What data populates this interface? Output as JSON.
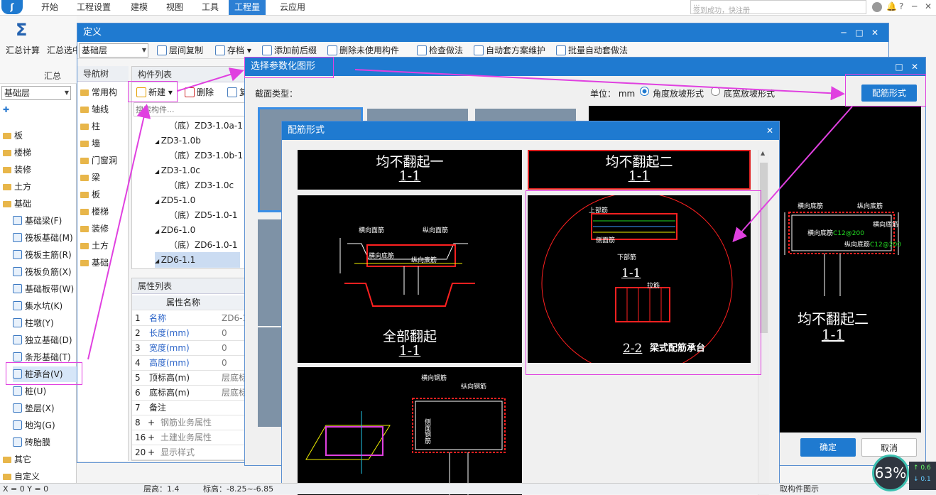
{
  "menubar": {
    "items": [
      "开始",
      "工程设置",
      "建模",
      "视图",
      "工具",
      "工程量",
      "云应用"
    ],
    "active": "工程量",
    "hint_lines": [
      "...",
      "签到成功，快注册"
    ]
  },
  "ribbon": {
    "btn1": "汇总计算",
    "btn2": "汇总选中",
    "group": "汇总"
  },
  "left_panel": {
    "layer": "基础层",
    "tree": [
      {
        "label": "板",
        "kind": "folder",
        "indent": 0
      },
      {
        "label": "楼梯",
        "kind": "folder",
        "indent": 0
      },
      {
        "label": "装修",
        "kind": "folder",
        "indent": 0
      },
      {
        "label": "土方",
        "kind": "folder",
        "indent": 0
      },
      {
        "label": "基础",
        "kind": "folder",
        "indent": 0
      },
      {
        "label": "基础梁(F)",
        "kind": "item",
        "indent": 1
      },
      {
        "label": "筏板基础(M)",
        "kind": "item",
        "indent": 1
      },
      {
        "label": "筏板主筋(R)",
        "kind": "item",
        "indent": 1
      },
      {
        "label": "筏板负筋(X)",
        "kind": "item",
        "indent": 1
      },
      {
        "label": "基础板带(W)",
        "kind": "item",
        "indent": 1
      },
      {
        "label": "集水坑(K)",
        "kind": "item",
        "indent": 1
      },
      {
        "label": "柱墩(Y)",
        "kind": "item",
        "indent": 1
      },
      {
        "label": "独立基础(D)",
        "kind": "item",
        "indent": 1
      },
      {
        "label": "条形基础(T)",
        "kind": "item",
        "indent": 1
      },
      {
        "label": "桩承台(V)",
        "kind": "item",
        "indent": 1
      },
      {
        "label": "桩(U)",
        "kind": "item",
        "indent": 1
      },
      {
        "label": "垫层(X)",
        "kind": "item",
        "indent": 1
      },
      {
        "label": "地沟(G)",
        "kind": "item",
        "indent": 1
      },
      {
        "label": "砖胎膜",
        "kind": "item",
        "indent": 1
      },
      {
        "label": "其它",
        "kind": "folder",
        "indent": 0
      },
      {
        "label": "自定义",
        "kind": "folder",
        "indent": 0
      }
    ]
  },
  "define_window": {
    "title": "定义",
    "layer": "基础层",
    "toolbar": [
      "层间复制",
      "存档",
      "添加前后缀",
      "删除未使用构件",
      "检查做法",
      "自动套方案维护",
      "批量自动套做法"
    ],
    "nav_title": "导航树",
    "nav_items": [
      "常用构",
      "轴线",
      "柱",
      "墙",
      "门窗洞",
      "梁",
      "板",
      "楼梯",
      "装修",
      "土方",
      "基础"
    ],
    "comp_title": "构件列表",
    "new_label": "新建",
    "delete_label": "删除",
    "copy_label": "复",
    "search_placeholder": "搜索构件...",
    "components": [
      {
        "label": "（底）ZD3-1.0a-1",
        "level": 2
      },
      {
        "label": "ZD3-1.0b",
        "level": 1
      },
      {
        "label": "（底）ZD3-1.0b-1",
        "level": 2
      },
      {
        "label": "ZD3-1.0c",
        "level": 1
      },
      {
        "label": "（底）ZD3-1.0c",
        "level": 2
      },
      {
        "label": "ZD5-1.0",
        "level": 1
      },
      {
        "label": "（底）ZD5-1.0-1",
        "level": 2
      },
      {
        "label": "ZD6-1.0",
        "level": 1
      },
      {
        "label": "（底）ZD6-1.0-1",
        "level": 2
      },
      {
        "label": "ZD6-1.1",
        "level": 1
      }
    ],
    "prop_title": "属性列表",
    "prop_header": "属性名称",
    "props": [
      {
        "no": "1",
        "name": "名称",
        "val": "ZD6-1",
        "blue": true,
        "exp": ""
      },
      {
        "no": "2",
        "name": "长度(mm)",
        "val": "0",
        "blue": true,
        "exp": ""
      },
      {
        "no": "3",
        "name": "宽度(mm)",
        "val": "0",
        "blue": true,
        "exp": ""
      },
      {
        "no": "4",
        "name": "高度(mm)",
        "val": "0",
        "blue": true,
        "exp": ""
      },
      {
        "no": "5",
        "name": "顶标高(m)",
        "val": "层底标",
        "blue": false,
        "exp": ""
      },
      {
        "no": "6",
        "name": "底标高(m)",
        "val": "层底标",
        "blue": false,
        "exp": ""
      },
      {
        "no": "7",
        "name": "备注",
        "val": "",
        "blue": false,
        "exp": ""
      },
      {
        "no": "8",
        "name": "钢筋业务属性",
        "val": "",
        "blue": false,
        "exp": "+"
      },
      {
        "no": "16",
        "name": "土建业务属性",
        "val": "",
        "blue": false,
        "exp": "+"
      },
      {
        "no": "20",
        "name": "显示样式",
        "val": "",
        "blue": false,
        "exp": "+"
      }
    ]
  },
  "param_window": {
    "title": "选择参数化图形",
    "section_label": "截面类型：",
    "unit_label": "单位：",
    "unit_value": "mm",
    "radio1": "角度放坡形式",
    "radio2": "底宽放坡形式",
    "rebar_button": "配筋形式",
    "ok": "确定",
    "cancel": "取消",
    "preview_title": "均不翻起二",
    "preview_sub": "1-1",
    "preview_labels": [
      "横向底筋",
      "纵向底筋",
      "横向底筋",
      "纵向底筋",
      "横向底筋"
    ],
    "preview_values": [
      "C12@200",
      "C12@200",
      "C12@200"
    ]
  },
  "rebar_window": {
    "title": "配筋形式",
    "cells": [
      {
        "title": "均不翻起一",
        "sub": "1-1"
      },
      {
        "title": "均不翻起二",
        "sub": "1-1"
      },
      {
        "title": "全部翻起",
        "sub": "1-1",
        "labels": [
          "横向面筋",
          "纵向面筋",
          "横向底筋",
          "纵向底筋"
        ]
      },
      {
        "title": "梁式配筋承台",
        "sub": "1-1",
        "sub2": "2-2",
        "labels": [
          "上部筋",
          "侧面筋",
          "下部筋",
          "拉筋"
        ]
      },
      {
        "title": "",
        "labels": [
          "横向钢筋",
          "纵向钢筋",
          "侧面钢筋"
        ]
      }
    ]
  },
  "status": {
    "coords": "X = 0 Y = 0",
    "floor_height": "层高：1.4",
    "elevation": "标高：-8.25~-6.85",
    "hint": "取构件图示",
    "gauge": "63%",
    "up": "0.6",
    "down": "0.1"
  },
  "colors": {
    "accent": "#1f7ad0",
    "annotation": "#e040e0",
    "cad_text": "#ffffff",
    "cad_red": "#ff2020",
    "cad_green": "#22dd22",
    "cad_yellow": "#f2f200"
  }
}
